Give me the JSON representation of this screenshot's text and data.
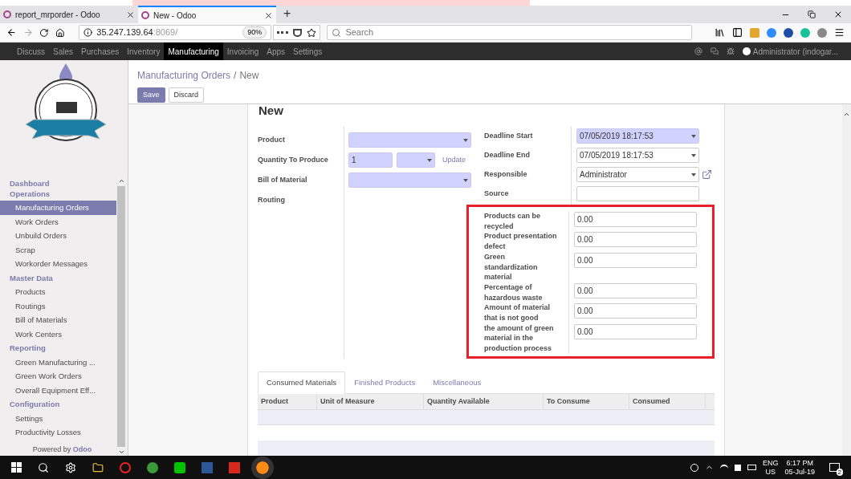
{
  "browser": {
    "tabs": [
      {
        "title": "report_mrporder - Odoo",
        "selected": false
      },
      {
        "title": "New - Odoo",
        "selected": true
      }
    ],
    "new_tab": "+",
    "address": {
      "host": "35.247.139.64",
      "rest": ":8069/",
      "zoom": "90%"
    },
    "search": {
      "placeholder": "Search"
    }
  },
  "app_menu": {
    "items": [
      {
        "label": "Discuss",
        "selected": false
      },
      {
        "label": "Sales",
        "selected": false
      },
      {
        "label": "Purchases",
        "selected": false
      },
      {
        "label": "Inventory",
        "selected": false
      },
      {
        "label": "Manufacturing",
        "selected": true
      },
      {
        "label": "Invoicing",
        "selected": false
      },
      {
        "label": "Apps",
        "selected": false
      },
      {
        "label": "Settings",
        "selected": false
      }
    ],
    "user": "Administrator (indogar..."
  },
  "sidebar": {
    "sections": [
      {
        "title": "Dashboard"
      },
      {
        "title": "Operations",
        "items": [
          {
            "label": "Manufacturing Orders",
            "selected": true
          },
          {
            "label": "Work Orders",
            "selected": false
          },
          {
            "label": "Unbuild Orders",
            "selected": false
          },
          {
            "label": "Scrap",
            "selected": false
          },
          {
            "label": "Workorder Messages",
            "selected": false
          }
        ]
      },
      {
        "title": "Master Data",
        "items": [
          {
            "label": "Products",
            "selected": false
          },
          {
            "label": "Routings",
            "selected": false
          },
          {
            "label": "Bill of Materials",
            "selected": false
          },
          {
            "label": "Work Centers",
            "selected": false
          }
        ]
      },
      {
        "title": "Reporting",
        "items": [
          {
            "label": "Green Manufacturing ...",
            "selected": false
          },
          {
            "label": "Green Work Orders",
            "selected": false
          },
          {
            "label": "Overall Equipment Eff...",
            "selected": false
          }
        ]
      },
      {
        "title": "Configuration",
        "items": [
          {
            "label": "Settings",
            "selected": false
          },
          {
            "label": "Productivity Losses",
            "selected": false
          }
        ]
      }
    ],
    "footer": {
      "prefix": "Powered by",
      "brand": "Odoo"
    }
  },
  "breadcrumb": {
    "parent": "Manufacturing Orders",
    "separator": "/",
    "current": "New"
  },
  "buttons": {
    "save": "Save",
    "discard": "Discard"
  },
  "form": {
    "title": "New",
    "left_fields": [
      {
        "label": "Product",
        "kind": "select",
        "required": true
      },
      {
        "label": "Quantity To Produce",
        "kind": "quantity",
        "value": "1",
        "required": true,
        "action": "Update"
      },
      {
        "label": "Bill of Material",
        "kind": "select",
        "required": true
      },
      {
        "label": "Routing",
        "kind": "none"
      }
    ],
    "right_fields": [
      {
        "label": "Deadline Start",
        "kind": "select",
        "value": "07/05/2019 18:17:53",
        "required": true
      },
      {
        "label": "Deadline End",
        "kind": "select",
        "value": "07/05/2019 18:17:53",
        "required": false
      },
      {
        "label": "Responsible",
        "kind": "link_select",
        "value": "Administrator",
        "required": false
      },
      {
        "label": "Source",
        "kind": "text",
        "required": false
      }
    ],
    "highlighted_fields": [
      {
        "label": "Products can be recycled",
        "value": "0.00"
      },
      {
        "label": "Product presentation defect",
        "value": "0.00"
      },
      {
        "label": "Green standardization material",
        "value": "0.00"
      },
      {
        "label": "Percentage of hazardous waste",
        "value": "0.00"
      },
      {
        "label": "Amount of material that is not good",
        "value": "0.00"
      },
      {
        "label": "the amount of green material in the production process",
        "value": "0.00"
      }
    ]
  },
  "notebook": {
    "tabs": [
      {
        "label": "Consumed Materials",
        "selected": true
      },
      {
        "label": "Finished Products",
        "selected": false
      },
      {
        "label": "Miscellaneous",
        "selected": false
      }
    ],
    "columns": [
      "Product",
      "Unit of Measure",
      "Quantity Available",
      "To Consume",
      "Consumed"
    ]
  },
  "taskbar": {
    "lang": "ENG",
    "region": "US",
    "time": "6:17 PM",
    "date": "05-Jul-19",
    "notifications": "2"
  }
}
